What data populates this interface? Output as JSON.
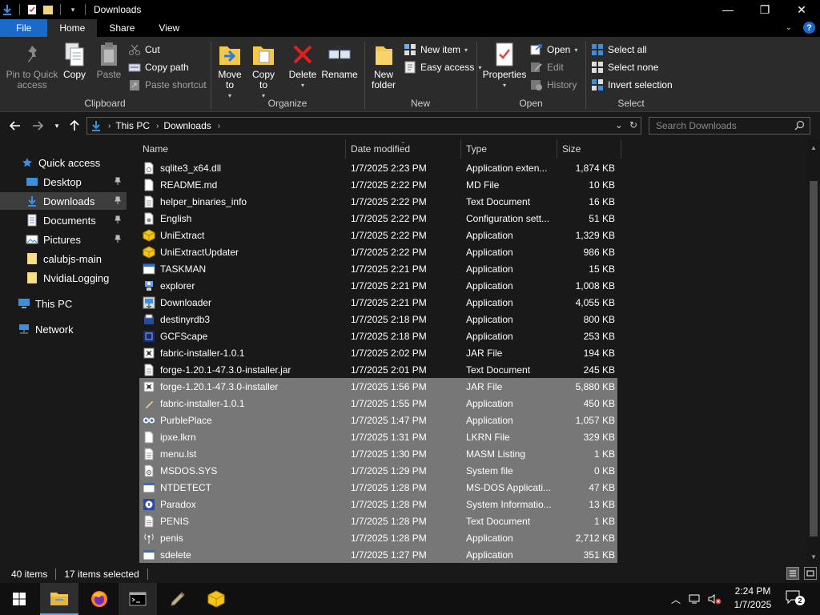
{
  "window": {
    "title": "Downloads",
    "controls": {
      "minimize": "—",
      "maximize": "❐",
      "close": "✕"
    }
  },
  "ribbon_tabs": [
    {
      "label": "File"
    },
    {
      "label": "Home"
    },
    {
      "label": "Share"
    },
    {
      "label": "View"
    }
  ],
  "ribbon": {
    "clipboard": {
      "label": "Clipboard",
      "pin": "Pin to Quick access",
      "copy": "Copy",
      "paste": "Paste",
      "cut": "Cut",
      "copy_path": "Copy path",
      "paste_shortcut": "Paste shortcut"
    },
    "organize": {
      "label": "Organize",
      "move_to": "Move to",
      "copy_to": "Copy to",
      "delete": "Delete",
      "rename": "Rename"
    },
    "new": {
      "label": "New",
      "new_folder": "New folder",
      "new_item": "New item",
      "easy_access": "Easy access"
    },
    "open": {
      "label": "Open",
      "properties": "Properties",
      "open": "Open",
      "edit": "Edit",
      "history": "History"
    },
    "select": {
      "label": "Select",
      "select_all": "Select all",
      "select_none": "Select none",
      "invert_selection": "Invert selection"
    }
  },
  "address": {
    "crumbs": [
      "This PC",
      "Downloads"
    ],
    "search_placeholder": "Search Downloads"
  },
  "nav_pane": [
    {
      "label": "Quick access",
      "icon": "star-icon",
      "pinned": false,
      "selected": false
    },
    {
      "label": "Desktop",
      "icon": "desktop-icon",
      "pinned": true,
      "selected": false
    },
    {
      "label": "Downloads",
      "icon": "download-icon",
      "pinned": true,
      "selected": true
    },
    {
      "label": "Documents",
      "icon": "documents-icon",
      "pinned": true,
      "selected": false
    },
    {
      "label": "Pictures",
      "icon": "pictures-icon",
      "pinned": true,
      "selected": false
    },
    {
      "label": "calubjs-main",
      "icon": "folder-icon",
      "pinned": false,
      "selected": false
    },
    {
      "label": "NvidiaLogging",
      "icon": "folder-icon",
      "pinned": false,
      "selected": false
    },
    {
      "label": "This PC",
      "icon": "computer-icon",
      "pinned": false,
      "selected": false
    },
    {
      "label": "Network",
      "icon": "network-icon",
      "pinned": false,
      "selected": false
    }
  ],
  "columns": {
    "name": "Name",
    "date": "Date modified",
    "type": "Type",
    "size": "Size"
  },
  "files": [
    {
      "name": "sqlite3_x64.dll",
      "date": "1/7/2025 2:23 PM",
      "type": "Application exten...",
      "size": "1,874 KB",
      "icon": "dll-icon",
      "selected": false
    },
    {
      "name": "README.md",
      "date": "1/7/2025 2:22 PM",
      "type": "MD File",
      "size": "10 KB",
      "icon": "file-icon",
      "selected": false
    },
    {
      "name": "helper_binaries_info",
      "date": "1/7/2025 2:22 PM",
      "type": "Text Document",
      "size": "16 KB",
      "icon": "text-file-icon",
      "selected": false
    },
    {
      "name": "English",
      "date": "1/7/2025 2:22 PM",
      "type": "Configuration sett...",
      "size": "51 KB",
      "icon": "config-icon",
      "selected": false
    },
    {
      "name": "UniExtract",
      "date": "1/7/2025 2:22 PM",
      "type": "Application",
      "size": "1,329 KB",
      "icon": "uniextract-icon",
      "selected": false
    },
    {
      "name": "UniExtractUpdater",
      "date": "1/7/2025 2:22 PM",
      "type": "Application",
      "size": "986 KB",
      "icon": "uniextract-icon",
      "selected": false
    },
    {
      "name": "TASKMAN",
      "date": "1/7/2025 2:21 PM",
      "type": "Application",
      "size": "15 KB",
      "icon": "app-window-icon",
      "selected": false
    },
    {
      "name": "explorer",
      "date": "1/7/2025 2:21 PM",
      "type": "Application",
      "size": "1,008 KB",
      "icon": "explorer-icon",
      "selected": false
    },
    {
      "name": "Downloader",
      "date": "1/7/2025 2:21 PM",
      "type": "Application",
      "size": "4,055 KB",
      "icon": "downloader-icon",
      "selected": false
    },
    {
      "name": "destinyrdb3",
      "date": "1/7/2025 2:18 PM",
      "type": "Application",
      "size": "800 KB",
      "icon": "app-icon",
      "selected": false
    },
    {
      "name": "GCFScape",
      "date": "1/7/2025 2:18 PM",
      "type": "Application",
      "size": "253 KB",
      "icon": "gcfscape-icon",
      "selected": false
    },
    {
      "name": "fabric-installer-1.0.1",
      "date": "1/7/2025 2:02 PM",
      "type": "JAR File",
      "size": "194 KB",
      "icon": "jar-icon",
      "selected": false
    },
    {
      "name": "forge-1.20.1-47.3.0-installer.jar",
      "date": "1/7/2025 2:01 PM",
      "type": "Text Document",
      "size": "245 KB",
      "icon": "text-file-icon",
      "selected": false
    },
    {
      "name": "forge-1.20.1-47.3.0-installer",
      "date": "1/7/2025 1:56 PM",
      "type": "JAR File",
      "size": "5,880 KB",
      "icon": "jar-icon",
      "selected": true
    },
    {
      "name": "fabric-installer-1.0.1",
      "date": "1/7/2025 1:55 PM",
      "type": "Application",
      "size": "450 KB",
      "icon": "fabric-icon",
      "selected": true
    },
    {
      "name": "PurblePlace",
      "date": "1/7/2025 1:47 PM",
      "type": "Application",
      "size": "1,057 KB",
      "icon": "purble-icon",
      "selected": true
    },
    {
      "name": "ipxe.lkrn",
      "date": "1/7/2025 1:31 PM",
      "type": "LKRN File",
      "size": "329 KB",
      "icon": "file-icon",
      "selected": true
    },
    {
      "name": "menu.lst",
      "date": "1/7/2025 1:30 PM",
      "type": "MASM Listing",
      "size": "1 KB",
      "icon": "text-file-icon",
      "selected": true
    },
    {
      "name": "MSDOS.SYS",
      "date": "1/7/2025 1:29 PM",
      "type": "System file",
      "size": "0 KB",
      "icon": "system-file-icon",
      "selected": true
    },
    {
      "name": "NTDETECT",
      "date": "1/7/2025 1:28 PM",
      "type": "MS-DOS Applicati...",
      "size": "47 KB",
      "icon": "app-window-icon",
      "selected": true
    },
    {
      "name": "Paradox",
      "date": "1/7/2025 1:28 PM",
      "type": "System Informatio...",
      "size": "13 KB",
      "icon": "sysinfo-icon",
      "selected": true
    },
    {
      "name": "PENIS",
      "date": "1/7/2025 1:28 PM",
      "type": "Text Document",
      "size": "1 KB",
      "icon": "text-file-icon",
      "selected": true
    },
    {
      "name": "penis",
      "date": "1/7/2025 1:28 PM",
      "type": "Application",
      "size": "2,712 KB",
      "icon": "antenna-icon",
      "selected": true
    },
    {
      "name": "sdelete",
      "date": "1/7/2025 1:27 PM",
      "type": "Application",
      "size": "351 KB",
      "icon": "app-window-icon",
      "selected": true
    }
  ],
  "status": {
    "items": "40 items",
    "selected": "17 items selected"
  },
  "taskbar": {
    "clock_time": "2:24 PM",
    "clock_date": "1/7/2025",
    "notification_count": "2"
  },
  "colors": {
    "accent": "#1a6ac9",
    "selection": "#777777",
    "background": "#191919",
    "ribbon": "#2b2b2b"
  }
}
